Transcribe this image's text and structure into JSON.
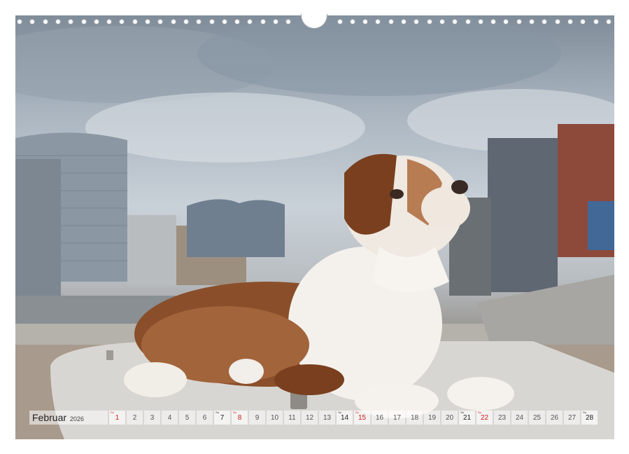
{
  "calendar": {
    "month": "Februar",
    "year": "2026",
    "days": [
      {
        "n": "1",
        "wd": "So",
        "type": "sun"
      },
      {
        "n": "2",
        "wd": "",
        "type": "normal"
      },
      {
        "n": "3",
        "wd": "",
        "type": "normal"
      },
      {
        "n": "4",
        "wd": "",
        "type": "normal"
      },
      {
        "n": "5",
        "wd": "",
        "type": "normal"
      },
      {
        "n": "6",
        "wd": "",
        "type": "normal"
      },
      {
        "n": "7",
        "wd": "Sa",
        "type": "sat"
      },
      {
        "n": "8",
        "wd": "So",
        "type": "sun"
      },
      {
        "n": "9",
        "wd": "",
        "type": "normal"
      },
      {
        "n": "10",
        "wd": "",
        "type": "normal"
      },
      {
        "n": "11",
        "wd": "",
        "type": "normal"
      },
      {
        "n": "12",
        "wd": "",
        "type": "normal"
      },
      {
        "n": "13",
        "wd": "",
        "type": "normal"
      },
      {
        "n": "14",
        "wd": "Sa",
        "type": "sat"
      },
      {
        "n": "15",
        "wd": "So",
        "type": "sun"
      },
      {
        "n": "16",
        "wd": "",
        "type": "normal"
      },
      {
        "n": "17",
        "wd": "",
        "type": "normal"
      },
      {
        "n": "18",
        "wd": "",
        "type": "normal"
      },
      {
        "n": "19",
        "wd": "",
        "type": "normal"
      },
      {
        "n": "20",
        "wd": "",
        "type": "normal"
      },
      {
        "n": "21",
        "wd": "Sa",
        "type": "sat"
      },
      {
        "n": "22",
        "wd": "So",
        "type": "sun"
      },
      {
        "n": "23",
        "wd": "",
        "type": "normal"
      },
      {
        "n": "24",
        "wd": "",
        "type": "normal"
      },
      {
        "n": "25",
        "wd": "",
        "type": "normal"
      },
      {
        "n": "26",
        "wd": "",
        "type": "normal"
      },
      {
        "n": "27",
        "wd": "",
        "type": "normal"
      },
      {
        "n": "28",
        "wd": "Sa",
        "type": "sat"
      }
    ]
  },
  "colors": {
    "sunday": "#d11a1a",
    "accent_sky": "#a9b4bf"
  }
}
